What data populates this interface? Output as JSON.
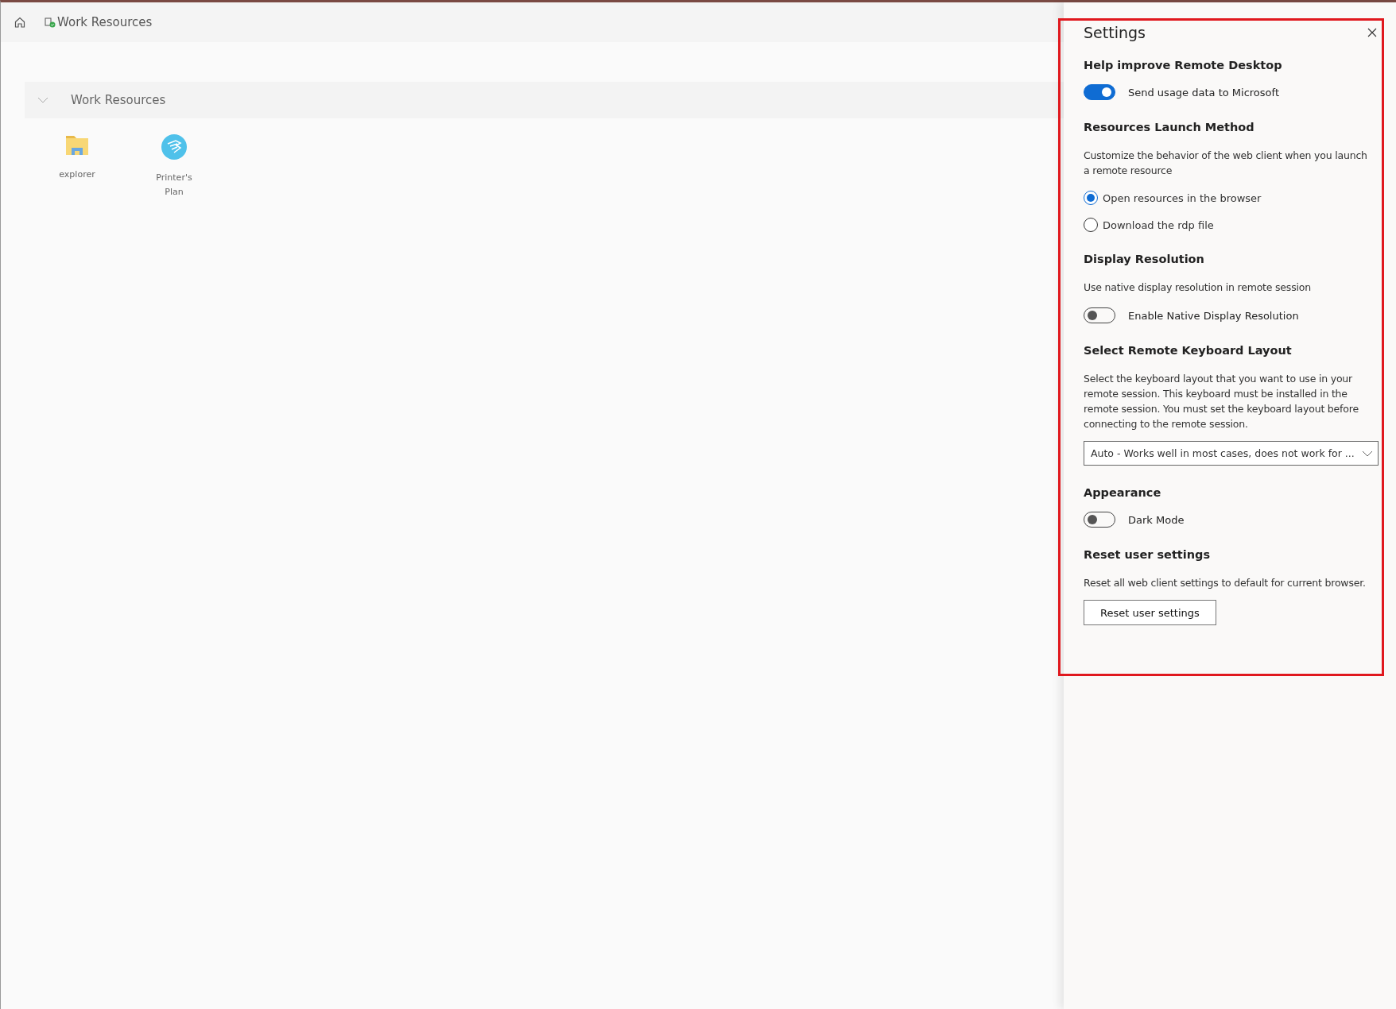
{
  "top_bar": {
    "title": "Work Resources"
  },
  "group": {
    "title": "Work Resources",
    "expanded": true,
    "apps": [
      {
        "kind": "folder",
        "name": "explorer"
      },
      {
        "kind": "disc",
        "name": "Printer's Plan"
      }
    ]
  },
  "settings": {
    "title": "Settings",
    "sections": [
      {
        "heading": "Help improve Remote Desktop",
        "items": [
          {
            "kind": "toggle",
            "label": "Send usage data to Microsoft",
            "on": true
          }
        ]
      },
      {
        "heading": "Resources Launch Method",
        "items": [
          {
            "kind": "text",
            "text": "Customize the behavior of the web client when you launch a remote resource"
          },
          {
            "kind": "radio",
            "label": "Open resources in the browser",
            "selected": true
          },
          {
            "kind": "radio",
            "label": "Download the rdp file",
            "selected": false
          }
        ]
      },
      {
        "heading": "Display Resolution",
        "items": [
          {
            "kind": "text",
            "text": "Use native display resolution in remote session"
          },
          {
            "kind": "toggle",
            "label": "Enable Native Display Resolution",
            "on": false
          }
        ]
      },
      {
        "heading": "Select Remote Keyboard Layout",
        "items": [
          {
            "kind": "text",
            "text": "Select the keyboard layout that you want to use in your remote session. This keyboard must be installed in the remote session. You must set the keyboard layout before connecting to the remote session."
          },
          {
            "kind": "dropdown",
            "value": "Auto - Works well in most cases, does not work for ..."
          }
        ]
      },
      {
        "heading": "Appearance",
        "items": [
          {
            "kind": "toggle",
            "label": "Dark Mode",
            "on": false
          }
        ]
      },
      {
        "heading": "Reset user settings",
        "items": [
          {
            "kind": "text",
            "text": "Reset all web client settings to default for current browser."
          },
          {
            "kind": "button",
            "label": "Reset user settings"
          }
        ]
      }
    ]
  }
}
